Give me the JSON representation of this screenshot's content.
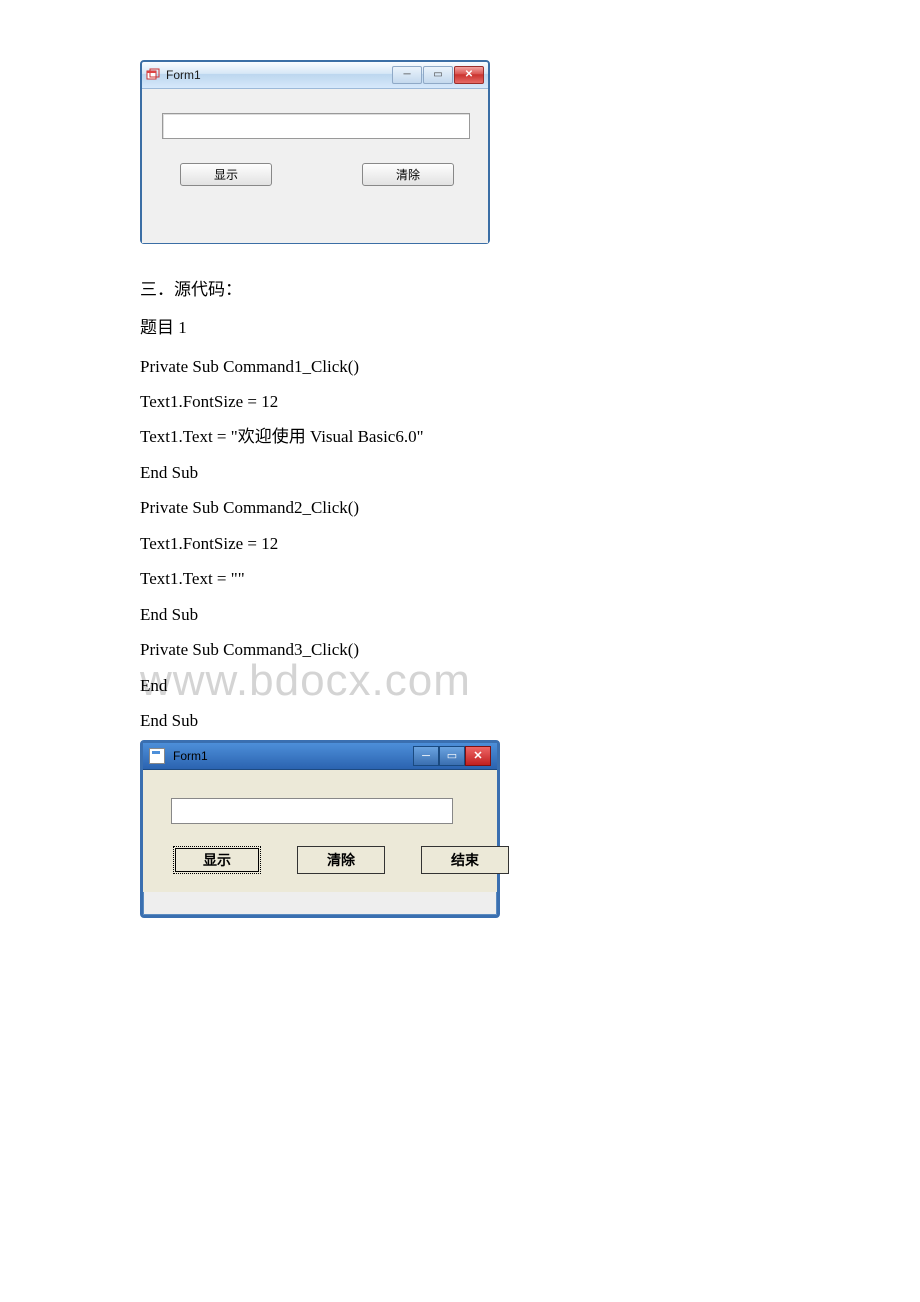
{
  "win1": {
    "title": "Form1",
    "btn1": "显示",
    "btn2": "清除"
  },
  "text": {
    "heading": "三．源代码：",
    "sub": "题目 1"
  },
  "code": [
    "Private Sub Command1_Click()",
    "Text1.FontSize = 12",
    "Text1.Text = \"欢迎使用 Visual Basic6.0\"",
    "End Sub",
    "Private Sub Command2_Click()",
    "Text1.FontSize = 12",
    "Text1.Text = \"\"",
    "End Sub",
    "Private Sub Command3_Click()",
    "End",
    "End Sub"
  ],
  "watermark": "www.bdocx.com",
  "win2": {
    "title": "Form1",
    "btn1": "显示",
    "btn2": "清除",
    "btn3": "结束"
  }
}
